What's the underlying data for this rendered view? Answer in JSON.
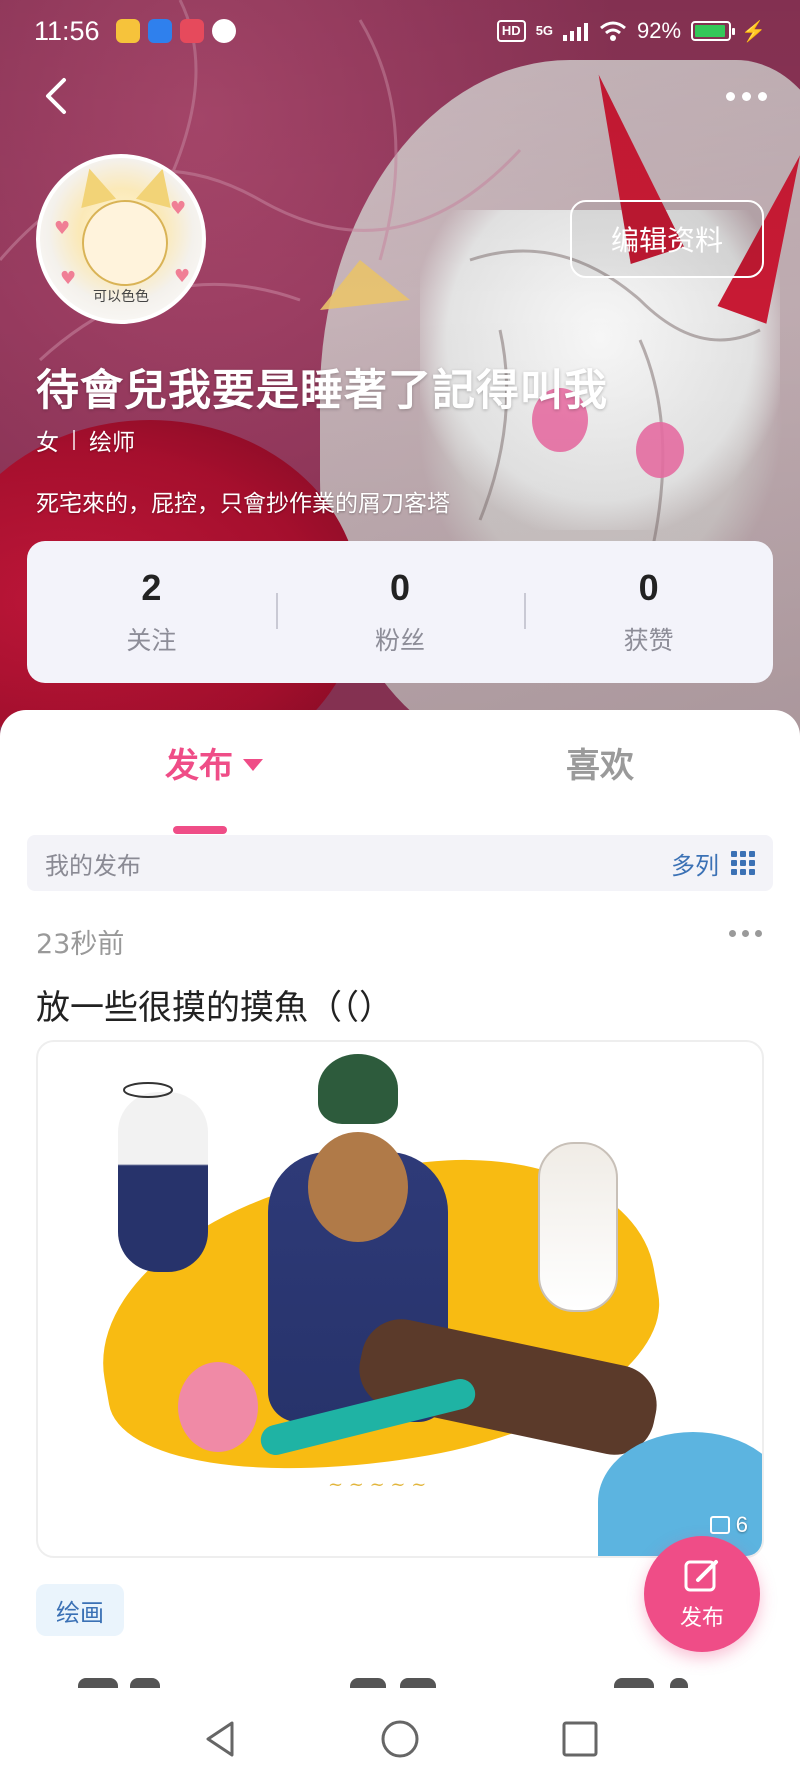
{
  "status_bar": {
    "time": "11:56",
    "hd": "HD",
    "network": "5G",
    "battery": "92%",
    "battery_level": 0.92
  },
  "profile": {
    "avatar_caption": "可以色色",
    "edit_button": "编辑资料",
    "username": "待會兒我要是睡著了記得叫我",
    "gender": "女",
    "role": "绘师",
    "bio": "死宅來的，屁控，只會抄作業的屑刀客塔"
  },
  "stats": [
    {
      "value": "2",
      "label": "关注"
    },
    {
      "value": "0",
      "label": "粉丝"
    },
    {
      "value": "0",
      "label": "获赞"
    }
  ],
  "tabs": {
    "active": "发布",
    "inactive": "喜欢"
  },
  "filter": {
    "label": "我的发布",
    "view_mode": "多列"
  },
  "post": {
    "time": "23秒前",
    "title": "放一些很摸的摸魚（（）",
    "image_count": "6",
    "tag": "绘画"
  },
  "fab": {
    "label": "发布"
  },
  "colors": {
    "accent": "#ef4d87",
    "link": "#3b71b5",
    "hero_bg": "#963a5e"
  }
}
